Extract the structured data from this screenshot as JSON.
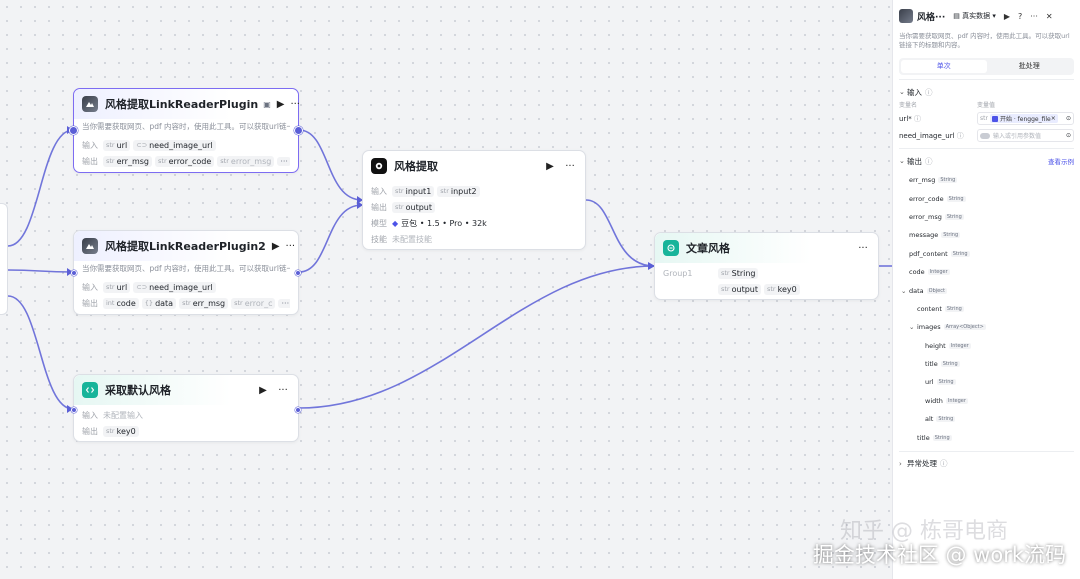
{
  "nodes": {
    "link1": {
      "title": "风格提取LinkReaderPlugin",
      "desc": "当你需要获取网页、pdf 内容时，使用此工具。可以获取url链一",
      "input_label": "输入",
      "inputs": [
        {
          "type": "str",
          "name": "url"
        },
        {
          "type": "",
          "name": "need_image_url"
        }
      ],
      "output_label": "输出",
      "outputs": [
        {
          "type": "str",
          "name": "err_msg"
        },
        {
          "type": "str",
          "name": "error_code"
        },
        {
          "type": "str",
          "name": "error_msg"
        }
      ],
      "more": "···"
    },
    "link2": {
      "title": "风格提取LinkReaderPlugin2",
      "desc": "当你需要获取网页、pdf 内容时，使用此工具。可以获取url链一",
      "input_label": "输入",
      "inputs": [
        {
          "type": "str",
          "name": "url"
        },
        {
          "type": "",
          "name": "need_image_url"
        }
      ],
      "output_label": "输出",
      "outputs": [
        {
          "type": "int",
          "name": "code"
        },
        {
          "type": "{}",
          "name": "data"
        },
        {
          "type": "str",
          "name": "err_msg"
        },
        {
          "type": "str",
          "name": "error_c"
        }
      ],
      "more": "···"
    },
    "default": {
      "title": "采取默认风格",
      "input_label": "输入",
      "input_empty": "未配置输入",
      "output_label": "输出",
      "outputs": [
        {
          "type": "str",
          "name": "key0"
        }
      ]
    },
    "extract": {
      "title": "风格提取",
      "input_label": "输入",
      "inputs": [
        {
          "type": "str",
          "name": "input1"
        },
        {
          "type": "str",
          "name": "input2"
        }
      ],
      "output_label": "输出",
      "outputs": [
        {
          "type": "str",
          "name": "output"
        }
      ],
      "model_label": "模型",
      "model": "豆包 • 1.5 • Pro • 32k",
      "skill_label": "技能",
      "skill": "未配置技能"
    },
    "article": {
      "title": "文章风格",
      "group": "Group1",
      "var_type": "str",
      "var": "String",
      "outputs": [
        {
          "type": "str",
          "name": "output"
        },
        {
          "type": "str",
          "name": "key0"
        }
      ]
    }
  },
  "panel": {
    "title": "风格···",
    "source": "真实数据",
    "desc": "当你需要获取网页、pdf 内容时，使用此工具。可以获取url链接下的标题和内容。",
    "tabs": [
      "单次",
      "批处理"
    ],
    "input_section": "输入",
    "col_name": "变量名",
    "col_value": "变量值",
    "inputs": [
      {
        "name": "url*",
        "type": "str",
        "ref": "开始 · fengge_file"
      },
      {
        "name": "need_image_url",
        "placeholder": "输入或引用参数值"
      }
    ],
    "output_section": "输出",
    "example_link": "查看示例",
    "outputs": [
      {
        "name": "err_msg",
        "type": "String",
        "level": 0
      },
      {
        "name": "error_code",
        "type": "String",
        "level": 0
      },
      {
        "name": "error_msg",
        "type": "String",
        "level": 0
      },
      {
        "name": "message",
        "type": "String",
        "level": 0
      },
      {
        "name": "pdf_content",
        "type": "String",
        "level": 0
      },
      {
        "name": "code",
        "type": "Integer",
        "level": 0
      },
      {
        "name": "data",
        "type": "Object",
        "level": 0,
        "caret": true
      },
      {
        "name": "content",
        "type": "String",
        "level": 1
      },
      {
        "name": "images",
        "type": "Array<Object>",
        "level": 1,
        "caret": true
      },
      {
        "name": "height",
        "type": "Integer",
        "level": 2
      },
      {
        "name": "title",
        "type": "String",
        "level": 2
      },
      {
        "name": "url",
        "type": "String",
        "level": 2
      },
      {
        "name": "width",
        "type": "Integer",
        "level": 2
      },
      {
        "name": "alt",
        "type": "String",
        "level": 2
      },
      {
        "name": "title",
        "type": "String",
        "level": 1
      }
    ],
    "error_section": "异常处理"
  },
  "watermark": "掘金技术社区 @ work流码",
  "watermark_faint": "知乎 @ 栋哥电商",
  "colors": {
    "edge": "#5b5fd6",
    "accent": "#4d53e8",
    "selected_border": "#7d6cf2"
  }
}
